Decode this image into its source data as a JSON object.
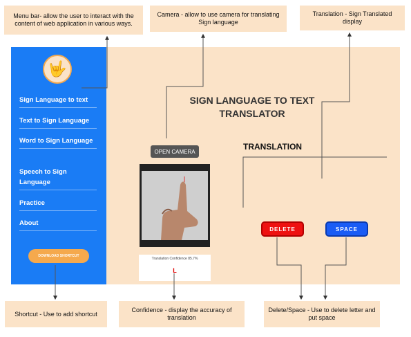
{
  "annotations": {
    "menu": "Menu bar- allow the user to interact with the content of web application in various ways.",
    "camera": "Camera - allow to use camera for translating Sign language",
    "translation": "Translation - Sign Translated display",
    "shortcut": "Shortcut - Use to add shortcut",
    "confidence": "Confidence - display the accuracy of translation",
    "delete_space": "Delete/Space - Use to delete letter and put space"
  },
  "sidebar": {
    "logo_icon": "sign-hand-icon",
    "items": [
      {
        "label": "Sign Language to text"
      },
      {
        "label": "Text to Sign Language"
      },
      {
        "label": "Word to Sign Language"
      },
      {
        "label": "Speech to Sign Language"
      },
      {
        "label": "Practice"
      },
      {
        "label": "About"
      }
    ],
    "shortcut_label": "DOWNLOAD SHORTCUT"
  },
  "main": {
    "title": "SIGN LANGUAGE TO TEXT TRANSLATOR",
    "translation_heading": "TRANSLATION",
    "open_camera_label": "OPEN CAMERA",
    "confidence_text": "Translation Confidence 85.7%",
    "detected_letter": "L",
    "delete_label": "DELETE",
    "space_label": "SPACE"
  },
  "colors": {
    "sidebar": "#1a7cf5",
    "panel": "#fbe3c8",
    "shortcut": "#f5a94d",
    "delete": "#ee1111",
    "space": "#1a5cf5"
  }
}
